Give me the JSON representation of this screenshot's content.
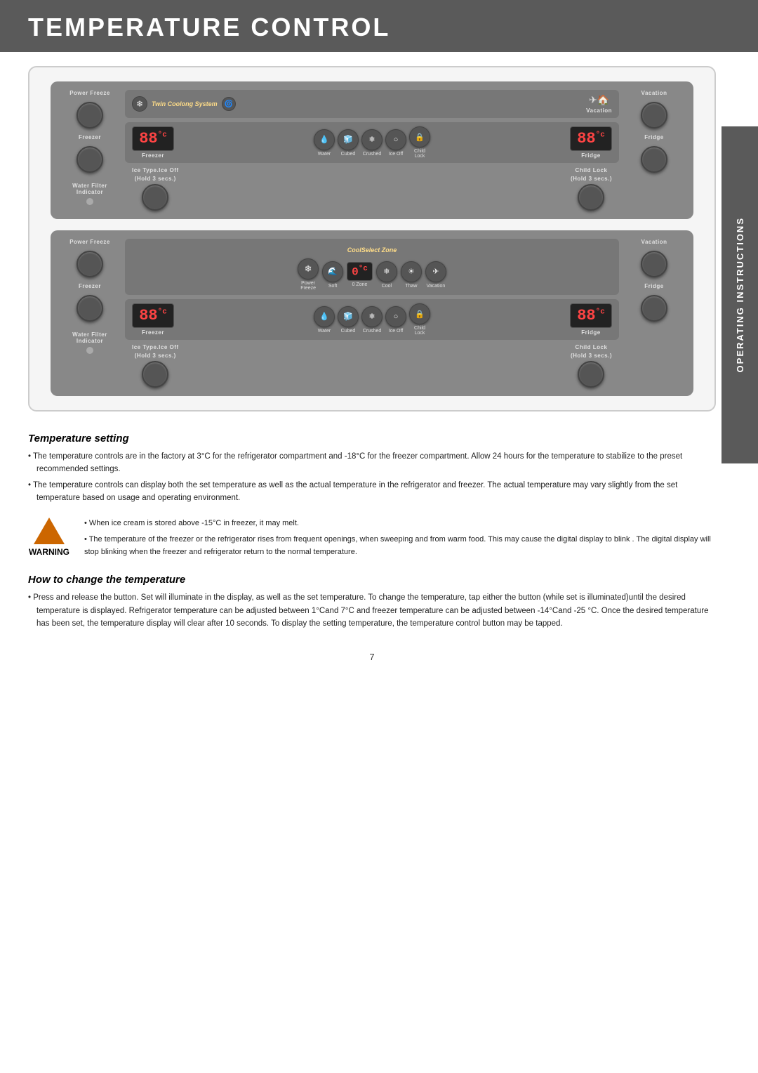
{
  "header": {
    "title": "Temperature Control",
    "background": "#5a5a5a"
  },
  "sidebar": {
    "label": "Operating Instructions"
  },
  "panels": [
    {
      "id": "panel1",
      "left": {
        "top_label": "Power Freeze",
        "mid_label": "Freezer",
        "bottom_label": "Water Filter\nIndicator"
      },
      "center": {
        "system_label": "Twin Coolong System",
        "vacation_icon": "✈",
        "vacation_label": "Vacation",
        "display_left": "88",
        "display_right": "88",
        "degree": "°c",
        "buttons": [
          "Freezer",
          "Water",
          "Cubed",
          "Crushed",
          "Ice Off",
          "Child\nLock",
          "Fridge"
        ],
        "bottom_left_label": "Ice Type.Ice Off\n(Hold 3 secs.)",
        "bottom_right_label": "Child Lock\n(Hold 3 secs.)"
      },
      "right": {
        "top_label": "Vacation",
        "mid_label": "Fridge"
      }
    },
    {
      "id": "panel2",
      "left": {
        "top_label": "Power Freeze",
        "mid_label": "Freezer",
        "bottom_label": "Water Filter\nIndicator"
      },
      "center": {
        "system_label": "CoolSelect Zone",
        "coolselect_buttons": [
          "Power\nFreeze",
          "Soft",
          "0 Zone",
          "Cool",
          "Thaw",
          "Vacation"
        ],
        "display_left": "88",
        "display_right": "88",
        "degree": "°c",
        "zero_display": "0",
        "buttons": [
          "Freezer",
          "Water",
          "Cubed",
          "Crushed",
          "Ice Off",
          "Child\nLock",
          "Fridge"
        ],
        "bottom_left_label": "Ice Type.Ice Off\n(Hold 3 secs.)",
        "bottom_right_label": "Child Lock\n(Hold 3 secs.)"
      },
      "right": {
        "top_label": "Vacation",
        "mid_label": "Fridge"
      }
    }
  ],
  "sections": [
    {
      "title": "Temperature setting",
      "paragraphs": [
        "• The temperature controls are in the factory at 3°C for the refrigerator compartment and -18°C for the freezer compartment. Allow 24 hours for the temperature to stabilize to the preset recommended settings.",
        "• The temperature controls can display both the set temperature as well as the actual temperature in the refrigerator and freezer. The actual temperature may vary slightly from the set temperature based on usage and operating environment."
      ]
    },
    {
      "title": "How to change the temperature",
      "paragraphs": [
        "• Press and release the button. Set will illuminate in the display, as well as the set temperature. To change the temperature, tap either the button (while set is illuminated)until the desired temperature is displayed. Refrigerator temperature can be adjusted between 1°Cand 7°C and freezer temperature can be adjusted between -14°Cand -25 °C. Once the desired temperature has been set, the temperature display will clear after 10 seconds. To display the setting temperature, the temperature control button may be tapped."
      ]
    }
  ],
  "warning": {
    "label": "WARNING",
    "bullets": [
      "• When ice cream is stored above -15°C in freezer, it may melt.",
      "• The temperature of the freezer or the refrigerator rises from frequent openings, when sweeping and from warm food. This may cause the digital display to blink . The digital display will stop blinking when the freezer and refrigerator return to the normal temperature."
    ]
  },
  "page_number": "7"
}
